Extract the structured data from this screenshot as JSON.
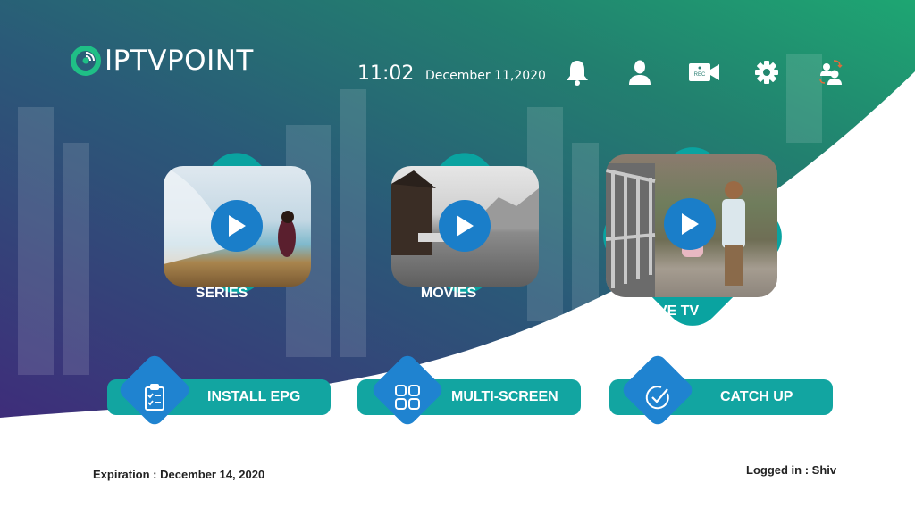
{
  "app": {
    "logo_text": "IPTVPOINT",
    "brand_colors": {
      "purple": "#3f2f78",
      "teal": "#12a5a1",
      "green": "#1ea476",
      "blue": "#1f83d0"
    }
  },
  "header": {
    "time": "11:02",
    "date": "December 11,2020",
    "icons": [
      {
        "name": "bell-icon",
        "label": "Notifications"
      },
      {
        "name": "user-icon",
        "label": "Profile"
      },
      {
        "name": "record-camera-icon",
        "label": "REC"
      },
      {
        "name": "gear-icon",
        "label": "Settings"
      },
      {
        "name": "switch-user-icon",
        "label": "Switch user"
      }
    ]
  },
  "tiles": [
    {
      "label": "SERIES",
      "icon": "play-icon"
    },
    {
      "label": "MOVIES",
      "icon": "play-icon"
    },
    {
      "label": "LIVE TV",
      "icon": "play-icon"
    }
  ],
  "actions": [
    {
      "label": "INSTALL EPG",
      "icon": "clipboard-checklist-icon"
    },
    {
      "label": "MULTI-SCREEN",
      "icon": "grid-four-icon"
    },
    {
      "label": "CATCH UP",
      "icon": "check-circle-icon"
    }
  ],
  "footer": {
    "expiration": "Expiration : December 14, 2020",
    "logged_in": "Logged in :  Shiv"
  }
}
